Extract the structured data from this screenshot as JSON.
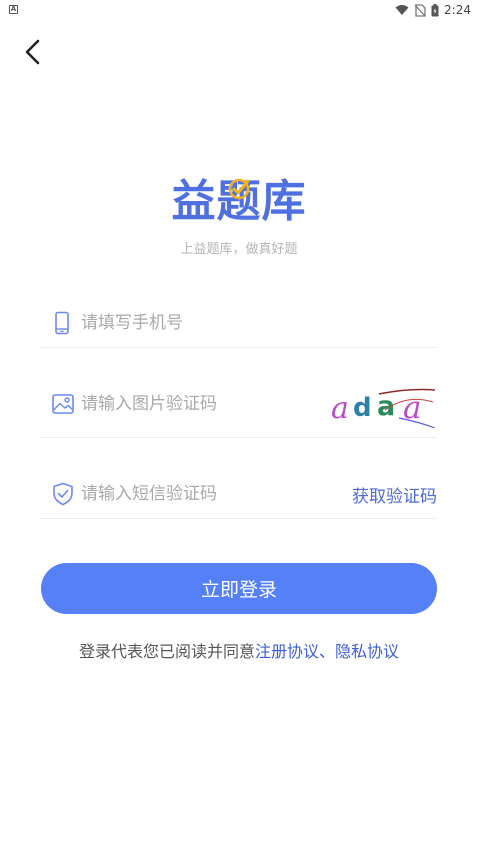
{
  "status_bar": {
    "time": "2:24",
    "left_badge": "A"
  },
  "logo": {
    "text": "益题库"
  },
  "tagline": "上益题库，做真好题",
  "phone_field": {
    "placeholder": "请填写手机号",
    "value": ""
  },
  "captcha_field": {
    "placeholder": "请输入图片验证码",
    "value": "",
    "captcha_text": "adaa"
  },
  "sms_field": {
    "placeholder": "请输入短信验证码",
    "value": "",
    "get_code_label": "获取验证码"
  },
  "login_button": {
    "label": "立即登录"
  },
  "agreement": {
    "prefix": "登录代表您已阅读并同意",
    "register_link": "注册协议",
    "separator": "、",
    "privacy_link": "隐私协议"
  },
  "colors": {
    "accent": "#5580f8",
    "link": "#3b5fd6",
    "logo": "#4f70e0",
    "check": "#f2b21c"
  }
}
